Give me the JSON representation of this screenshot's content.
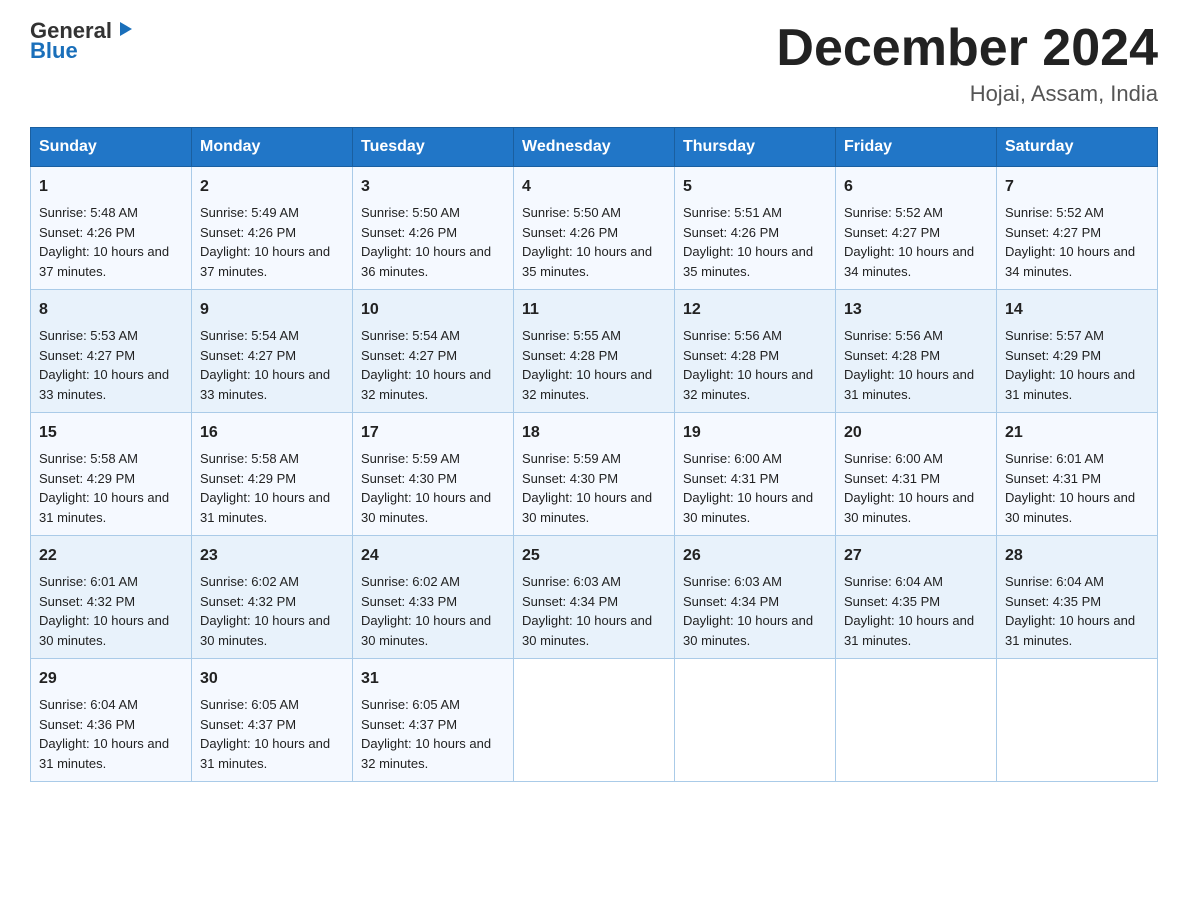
{
  "logo": {
    "line1": "General",
    "arrow": "▶",
    "line2": "Blue"
  },
  "header": {
    "month": "December 2024",
    "location": "Hojai, Assam, India"
  },
  "weekdays": [
    "Sunday",
    "Monday",
    "Tuesday",
    "Wednesday",
    "Thursday",
    "Friday",
    "Saturday"
  ],
  "weeks": [
    [
      {
        "day": "1",
        "sunrise": "5:48 AM",
        "sunset": "4:26 PM",
        "daylight": "10 hours and 37 minutes."
      },
      {
        "day": "2",
        "sunrise": "5:49 AM",
        "sunset": "4:26 PM",
        "daylight": "10 hours and 37 minutes."
      },
      {
        "day": "3",
        "sunrise": "5:50 AM",
        "sunset": "4:26 PM",
        "daylight": "10 hours and 36 minutes."
      },
      {
        "day": "4",
        "sunrise": "5:50 AM",
        "sunset": "4:26 PM",
        "daylight": "10 hours and 35 minutes."
      },
      {
        "day": "5",
        "sunrise": "5:51 AM",
        "sunset": "4:26 PM",
        "daylight": "10 hours and 35 minutes."
      },
      {
        "day": "6",
        "sunrise": "5:52 AM",
        "sunset": "4:27 PM",
        "daylight": "10 hours and 34 minutes."
      },
      {
        "day": "7",
        "sunrise": "5:52 AM",
        "sunset": "4:27 PM",
        "daylight": "10 hours and 34 minutes."
      }
    ],
    [
      {
        "day": "8",
        "sunrise": "5:53 AM",
        "sunset": "4:27 PM",
        "daylight": "10 hours and 33 minutes."
      },
      {
        "day": "9",
        "sunrise": "5:54 AM",
        "sunset": "4:27 PM",
        "daylight": "10 hours and 33 minutes."
      },
      {
        "day": "10",
        "sunrise": "5:54 AM",
        "sunset": "4:27 PM",
        "daylight": "10 hours and 32 minutes."
      },
      {
        "day": "11",
        "sunrise": "5:55 AM",
        "sunset": "4:28 PM",
        "daylight": "10 hours and 32 minutes."
      },
      {
        "day": "12",
        "sunrise": "5:56 AM",
        "sunset": "4:28 PM",
        "daylight": "10 hours and 32 minutes."
      },
      {
        "day": "13",
        "sunrise": "5:56 AM",
        "sunset": "4:28 PM",
        "daylight": "10 hours and 31 minutes."
      },
      {
        "day": "14",
        "sunrise": "5:57 AM",
        "sunset": "4:29 PM",
        "daylight": "10 hours and 31 minutes."
      }
    ],
    [
      {
        "day": "15",
        "sunrise": "5:58 AM",
        "sunset": "4:29 PM",
        "daylight": "10 hours and 31 minutes."
      },
      {
        "day": "16",
        "sunrise": "5:58 AM",
        "sunset": "4:29 PM",
        "daylight": "10 hours and 31 minutes."
      },
      {
        "day": "17",
        "sunrise": "5:59 AM",
        "sunset": "4:30 PM",
        "daylight": "10 hours and 30 minutes."
      },
      {
        "day": "18",
        "sunrise": "5:59 AM",
        "sunset": "4:30 PM",
        "daylight": "10 hours and 30 minutes."
      },
      {
        "day": "19",
        "sunrise": "6:00 AM",
        "sunset": "4:31 PM",
        "daylight": "10 hours and 30 minutes."
      },
      {
        "day": "20",
        "sunrise": "6:00 AM",
        "sunset": "4:31 PM",
        "daylight": "10 hours and 30 minutes."
      },
      {
        "day": "21",
        "sunrise": "6:01 AM",
        "sunset": "4:31 PM",
        "daylight": "10 hours and 30 minutes."
      }
    ],
    [
      {
        "day": "22",
        "sunrise": "6:01 AM",
        "sunset": "4:32 PM",
        "daylight": "10 hours and 30 minutes."
      },
      {
        "day": "23",
        "sunrise": "6:02 AM",
        "sunset": "4:32 PM",
        "daylight": "10 hours and 30 minutes."
      },
      {
        "day": "24",
        "sunrise": "6:02 AM",
        "sunset": "4:33 PM",
        "daylight": "10 hours and 30 minutes."
      },
      {
        "day": "25",
        "sunrise": "6:03 AM",
        "sunset": "4:34 PM",
        "daylight": "10 hours and 30 minutes."
      },
      {
        "day": "26",
        "sunrise": "6:03 AM",
        "sunset": "4:34 PM",
        "daylight": "10 hours and 30 minutes."
      },
      {
        "day": "27",
        "sunrise": "6:04 AM",
        "sunset": "4:35 PM",
        "daylight": "10 hours and 31 minutes."
      },
      {
        "day": "28",
        "sunrise": "6:04 AM",
        "sunset": "4:35 PM",
        "daylight": "10 hours and 31 minutes."
      }
    ],
    [
      {
        "day": "29",
        "sunrise": "6:04 AM",
        "sunset": "4:36 PM",
        "daylight": "10 hours and 31 minutes."
      },
      {
        "day": "30",
        "sunrise": "6:05 AM",
        "sunset": "4:37 PM",
        "daylight": "10 hours and 31 minutes."
      },
      {
        "day": "31",
        "sunrise": "6:05 AM",
        "sunset": "4:37 PM",
        "daylight": "10 hours and 32 minutes."
      },
      null,
      null,
      null,
      null
    ]
  ]
}
